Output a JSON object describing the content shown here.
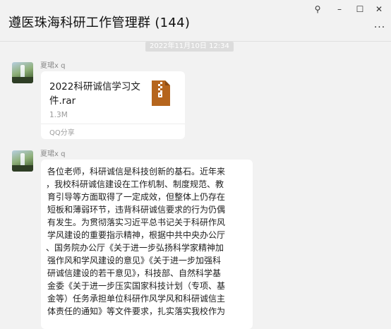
{
  "header": {
    "title": "遵医珠海科研工作管理群 (144)",
    "pin_icon": "⚲",
    "minimize_icon": "–",
    "maximize_icon": "☐",
    "close_icon": "✕",
    "more_icon": "..."
  },
  "chat": {
    "timestamp": "2022年11月10日 12:34",
    "messages": [
      {
        "sender": "夏珺x q",
        "avatar": "waterfall-avatar",
        "file": {
          "name_lines": [
            "2022科研诚信学习文",
            "件.rar"
          ],
          "size": "1.3M",
          "source": "QQ分享",
          "icon": "rar-archive-icon",
          "icon_color": "#b5651d"
        }
      },
      {
        "sender": "夏珺x q",
        "avatar": "waterfall-avatar",
        "text_lines": [
          "各位老师，科研诚信是科技创新的基石。近年来",
          "，我校科研诚信建设在工作机制、制度规范、教",
          "育引导等方面取得了一定成效，但整体上仍存在",
          "短板和薄弱环节，违背科研诚信要求的行为仍偶",
          "有发生。为贯彻落实习近平总书记关于科研作风",
          "学风建设的重要指示精神，根据中共中央办公厅",
          "、国务院办公厅《关于进一步弘扬科学家精神加",
          "强作风和学风建设的意见》《关于进一步加强科",
          "研诚信建设的若干意见》，科技部、自然科学基",
          "金委《关于进一步压实国家科技计划（专项、基",
          "金等）任务承担单位科研作风学风和科研诚信主",
          "体责任的通知》等文件要求，扎实落实我校作为"
        ]
      }
    ]
  }
}
